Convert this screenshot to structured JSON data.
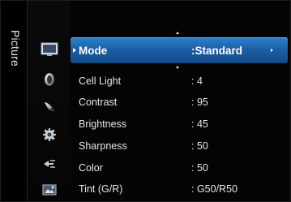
{
  "menu": {
    "category": "Picture",
    "selected_item": {
      "label": "Mode",
      "value": ":Standard"
    },
    "items": [
      {
        "label": "Cell Light",
        "value": ": 4"
      },
      {
        "label": "Contrast",
        "value": ": 95"
      },
      {
        "label": "Brightness",
        "value": ": 45"
      },
      {
        "label": "Sharpness",
        "value": ": 50"
      },
      {
        "label": "Color",
        "value": ": 50"
      },
      {
        "label": "Tint (G/R)",
        "value": ": G50/R50"
      }
    ],
    "icons": [
      "picture-icon",
      "sound-icon",
      "channel-icon",
      "setup-icon",
      "input-icon",
      "application-icon"
    ]
  },
  "colors": {
    "highlight": "#1c5fa6",
    "background": "#040404",
    "text": "#e6e6e6"
  }
}
